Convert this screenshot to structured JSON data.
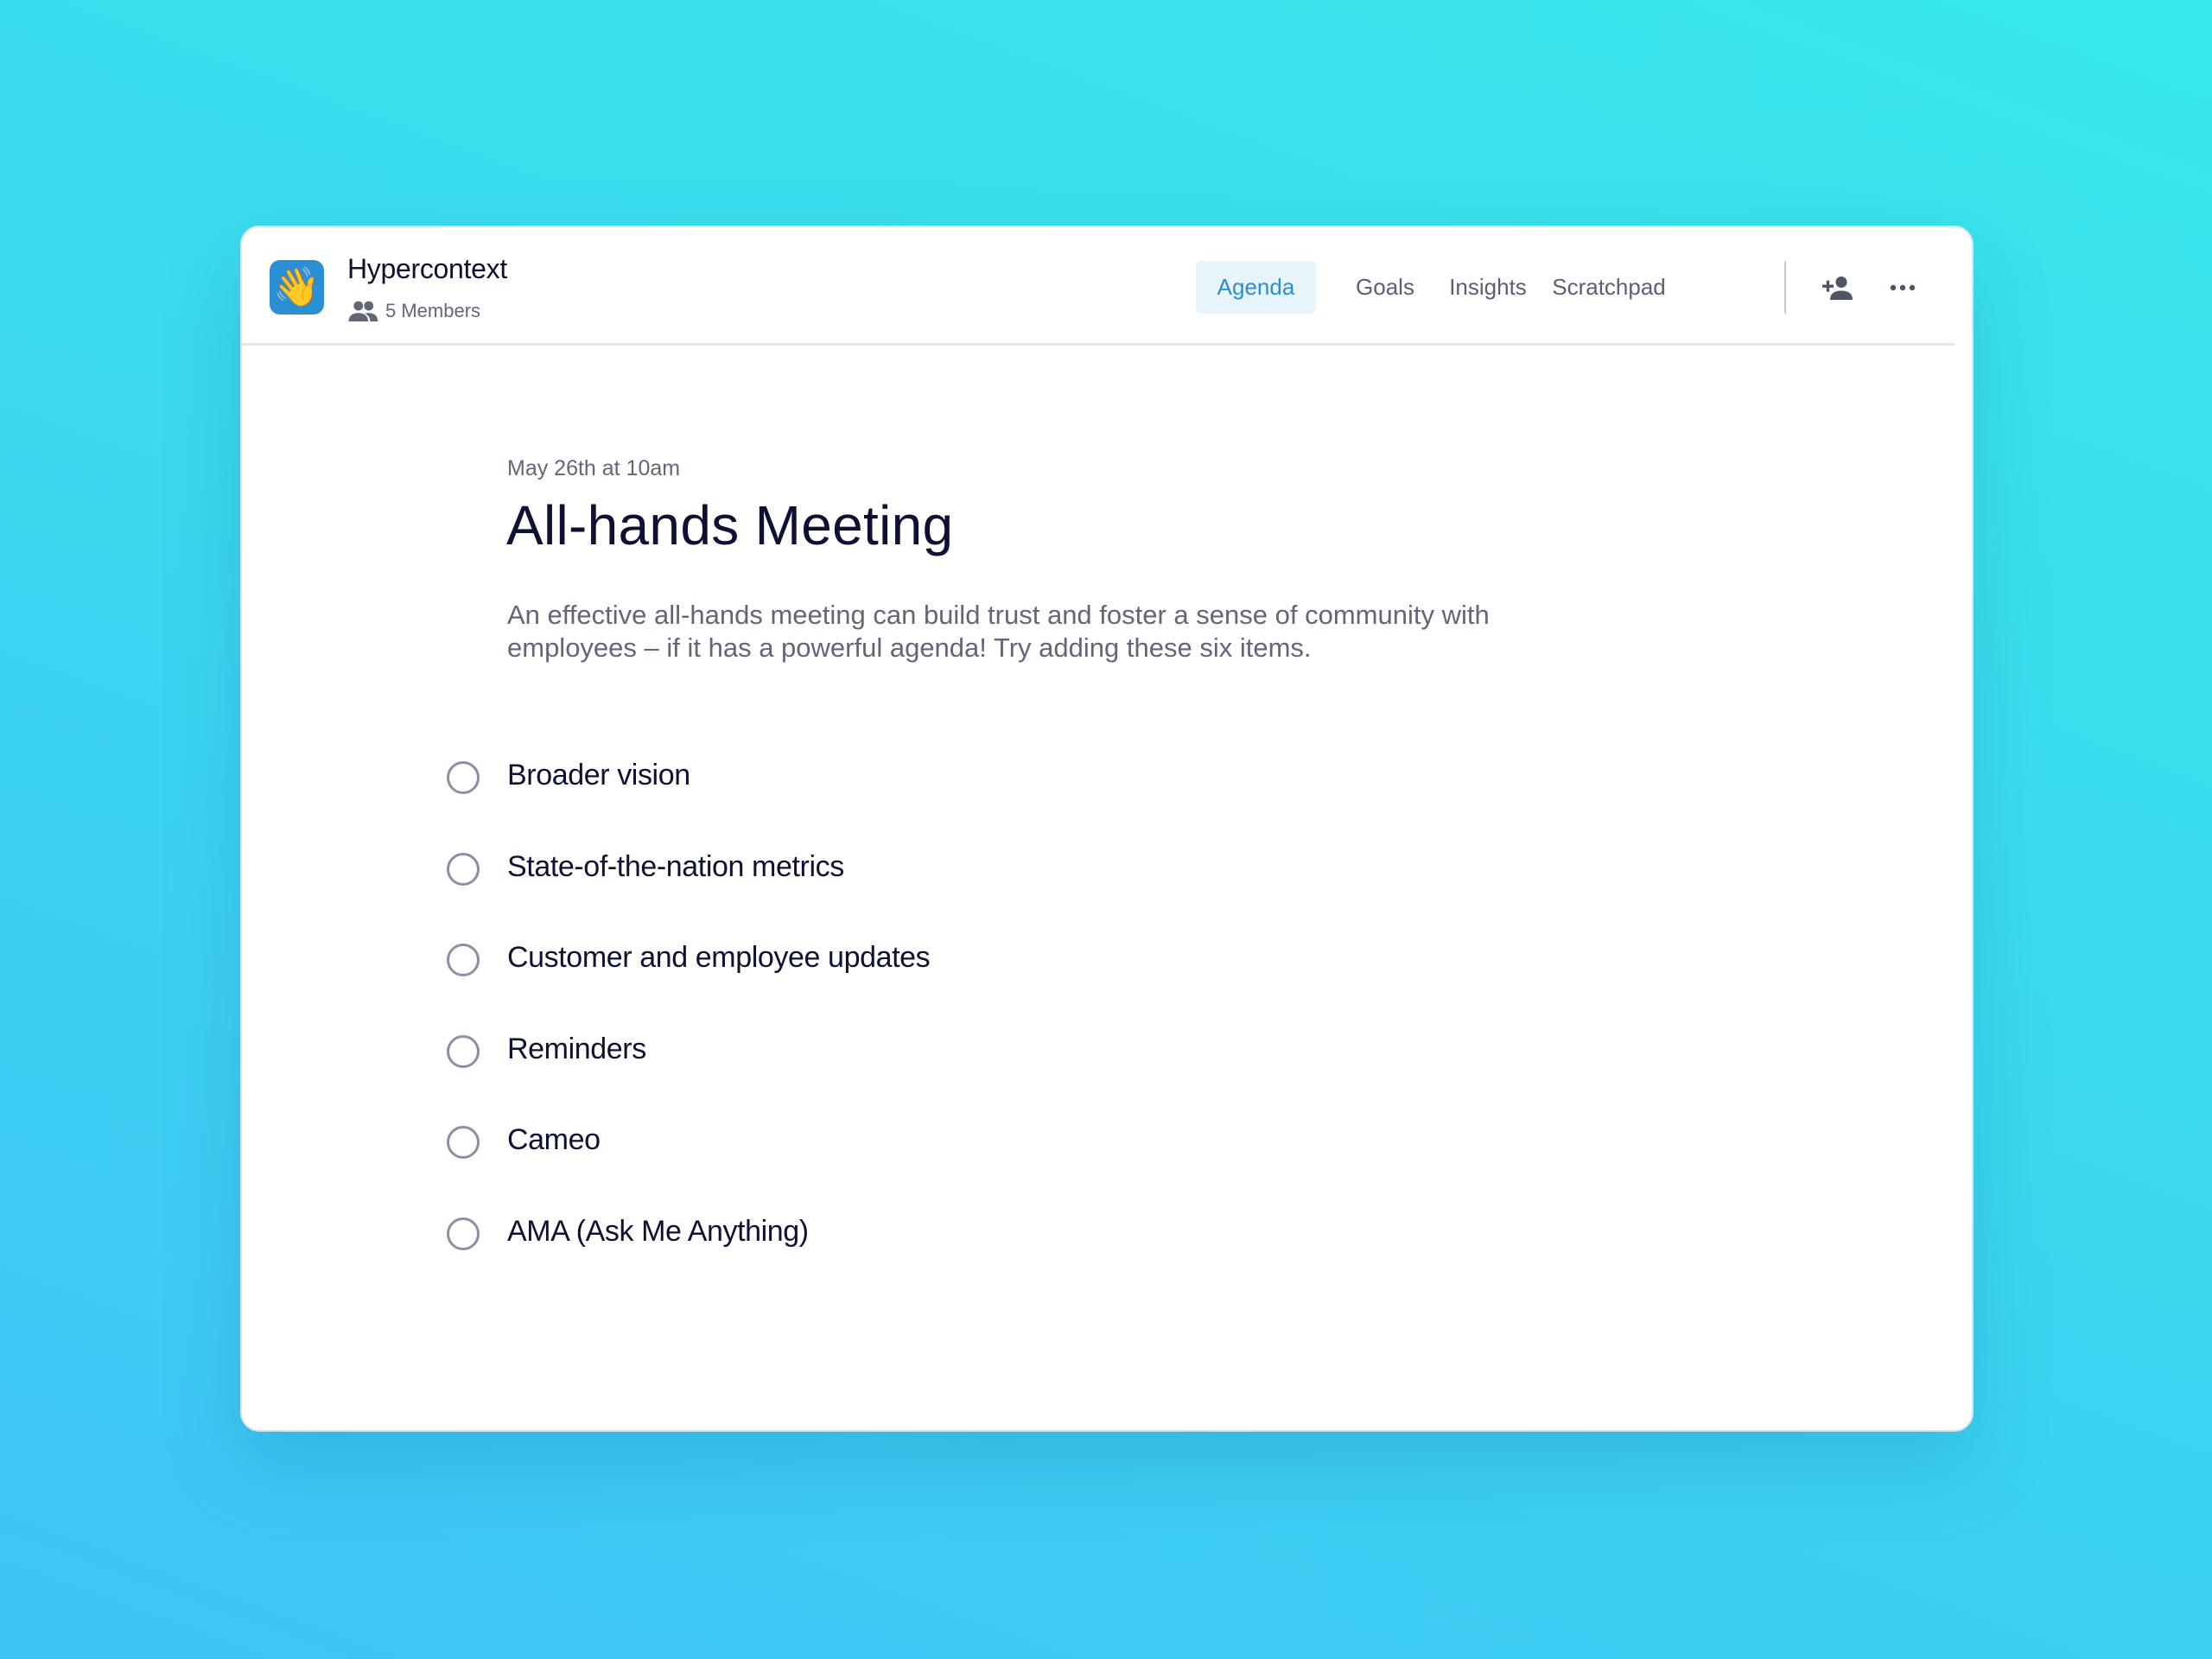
{
  "app": {
    "workspace_name": "Hypercontext",
    "members_label": "5 Members",
    "icon": "waving-hand-icon"
  },
  "tabs": [
    {
      "label": "Agenda",
      "active": true
    },
    {
      "label": "Goals",
      "active": false
    },
    {
      "label": "Insights",
      "active": false
    },
    {
      "label": "Scratchpad",
      "active": false
    }
  ],
  "toolbar": {
    "add_member_icon": "add-person-icon",
    "more_icon": "more-options-icon"
  },
  "meeting": {
    "date": "May 26th at 10am",
    "title": "All-hands Meeting",
    "description": "An effective all-hands meeting can build trust and foster a sense of community with employees – if it has a powerful agenda! Try adding these six items."
  },
  "agenda_items": [
    {
      "label": "Broader vision",
      "checked": false
    },
    {
      "label": "State-of-the-nation metrics",
      "checked": false
    },
    {
      "label": "Customer and employee updates",
      "checked": false
    },
    {
      "label": "Reminders",
      "checked": false
    },
    {
      "label": "Cameo",
      "checked": false
    },
    {
      "label": "AMA (Ask Me Anything)",
      "checked": false
    }
  ],
  "colors": {
    "accent": "#2b8dd1",
    "active_tab_bg": "#e8f4fb",
    "text_primary": "#0e1133",
    "text_secondary": "#626679",
    "app_icon_bg": "#2b8fd6"
  }
}
